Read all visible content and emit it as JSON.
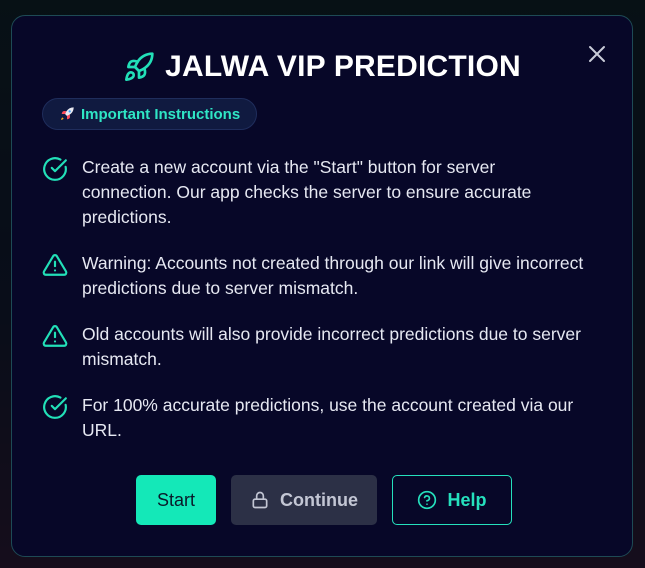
{
  "modal": {
    "title": "JALWA VIP PREDICTION",
    "badge_label": "Important Instructions",
    "instructions": [
      {
        "icon": "check-circle-icon",
        "text": "Create a new account via the \"Start\" button for server connection. Our app checks the server to ensure accurate predictions."
      },
      {
        "icon": "warning-triangle-icon",
        "text": "Warning: Accounts not created through our link will give incorrect predictions due to server mismatch."
      },
      {
        "icon": "warning-triangle-icon",
        "text": "Old accounts will also provide incorrect predictions due to server mismatch."
      },
      {
        "icon": "check-circle-icon",
        "text": "For 100% accurate predictions, use the account created via our URL."
      }
    ],
    "buttons": {
      "start_label": "Start",
      "continue_label": "Continue",
      "help_label": "Help"
    }
  },
  "colors": {
    "accent": "#14e8b8",
    "modal_bg": "#070728",
    "continue_bg": "#2c3046"
  }
}
